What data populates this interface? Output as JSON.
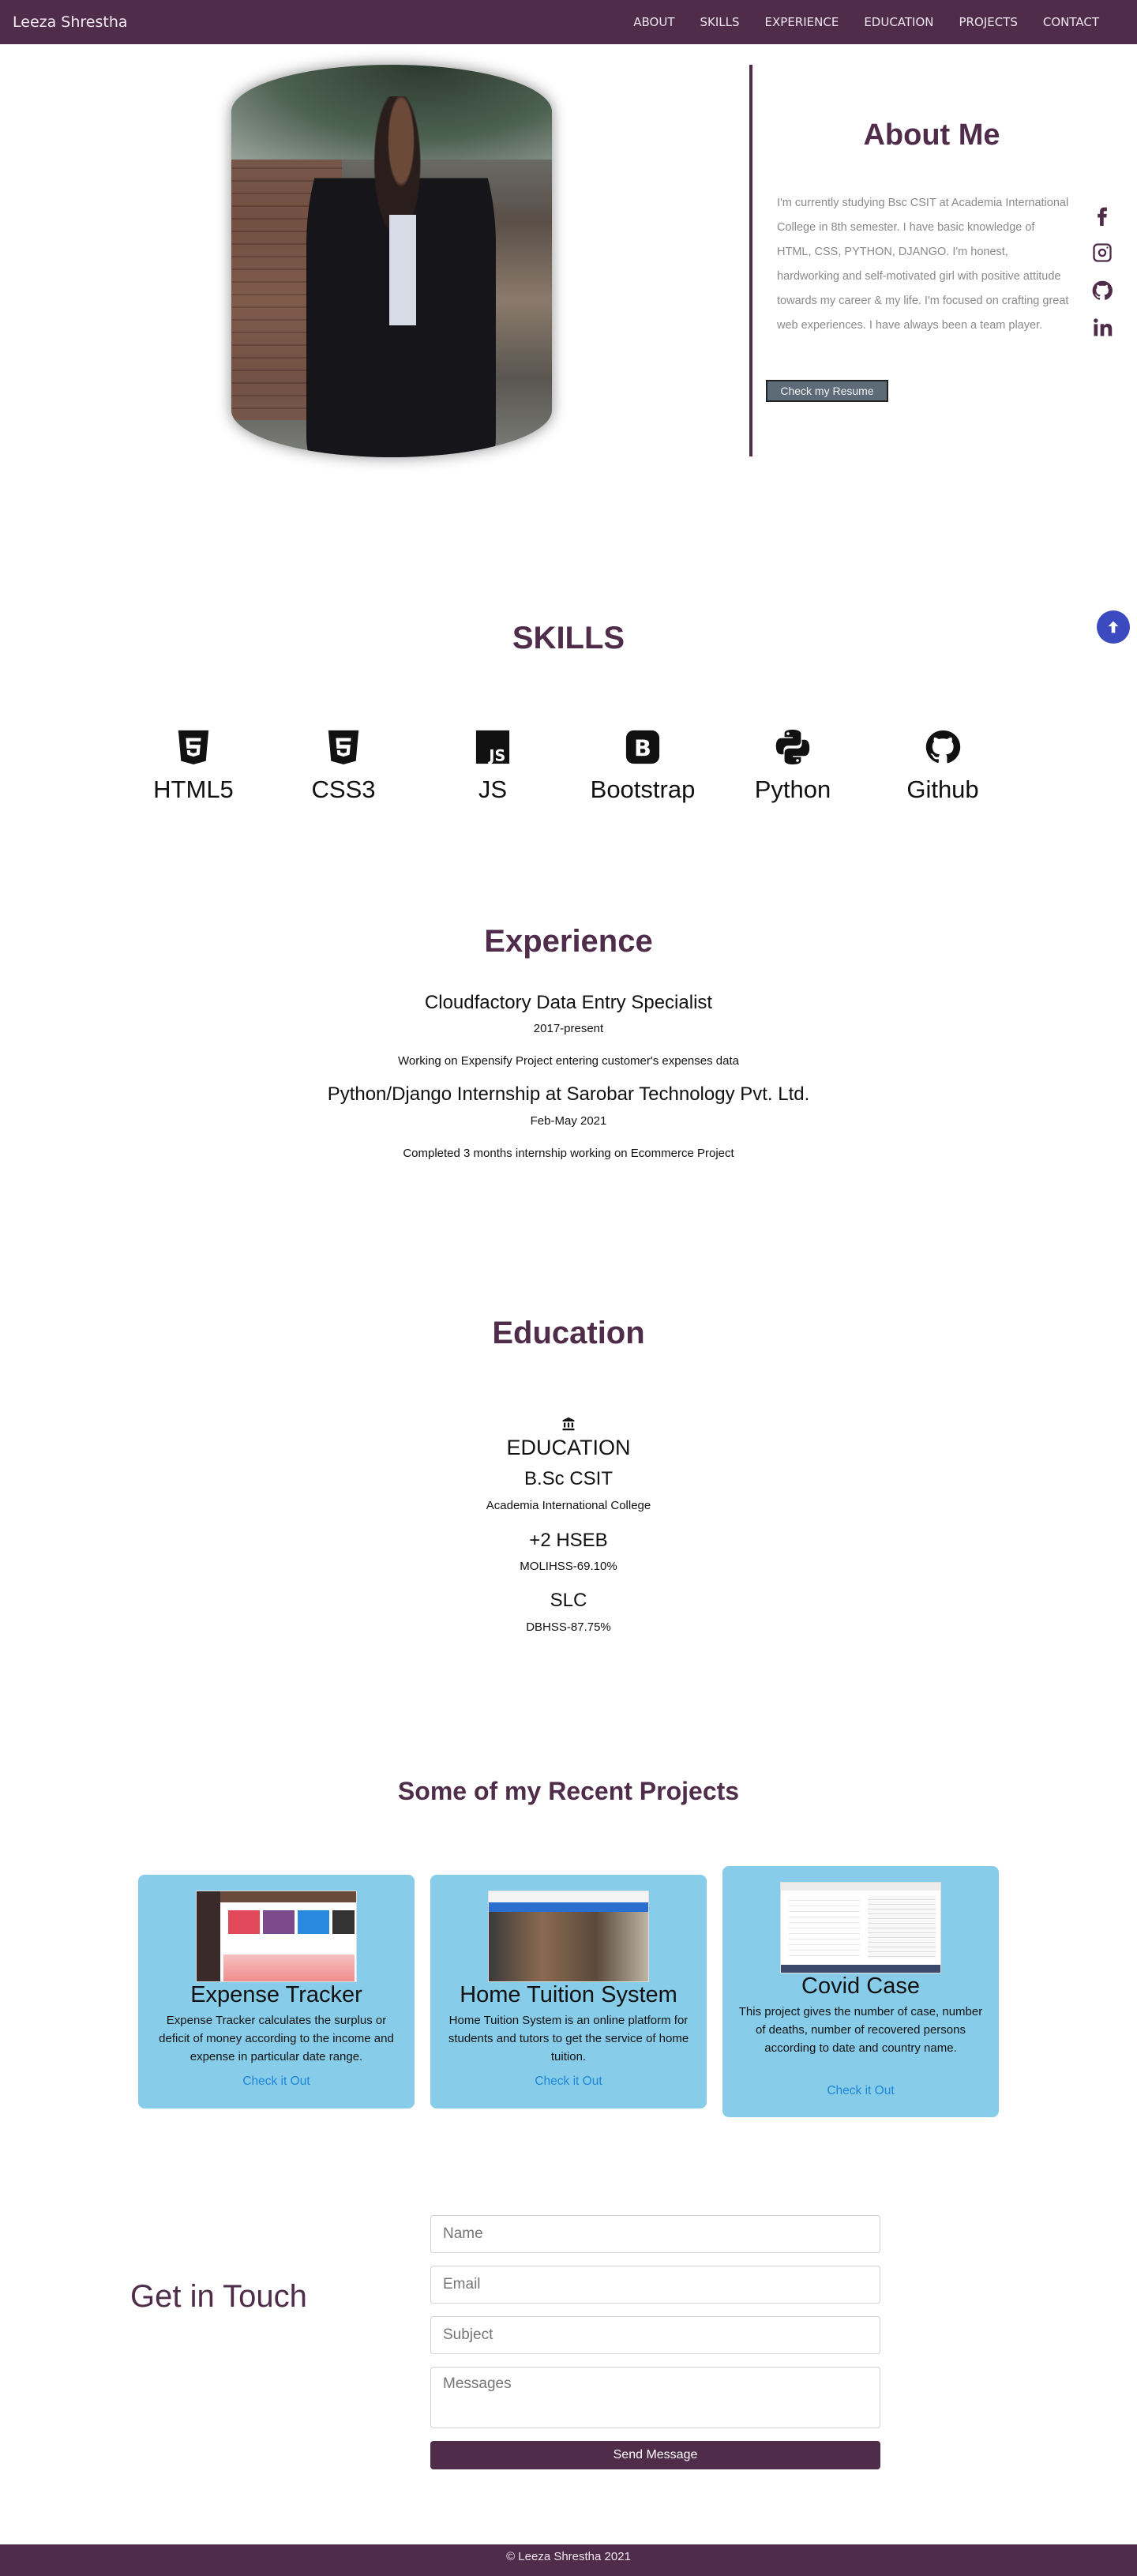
{
  "brand": "Leeza Shrestha",
  "nav": [
    "ABOUT",
    "SKILLS",
    "EXPERIENCE",
    "EDUCATION",
    "PROJECTS",
    "CONTACT"
  ],
  "about": {
    "title": "About Me",
    "text": "I'm currently studying Bsc CSIT at Academia International College in 8th semester. I have basic knowledge of HTML, CSS, PYTHON, DJANGO. I'm honest, hardworking and self-motivated girl with positive attitude towards my career & my life. I'm focused on crafting great web experiences. I have always been a team player.",
    "resume_button": "Check my Resume"
  },
  "social_icons": [
    "facebook-icon",
    "instagram-icon",
    "github-icon",
    "linkedin-icon"
  ],
  "skills": {
    "title": "SKILLS",
    "items": [
      "HTML5",
      "CSS3",
      "JS",
      "Bootstrap",
      "Python",
      "Github"
    ]
  },
  "experience": {
    "title": "Experience",
    "items": [
      {
        "role": "Cloudfactory Data Entry Specialist",
        "period": "2017-present",
        "desc": "Working on Expensify Project entering customer's expenses data"
      },
      {
        "role": "Python/Django Internship at Sarobar Technology Pvt. Ltd.",
        "period": "Feb-May 2021",
        "desc": "Completed 3 months internship working on Ecommerce Project"
      }
    ]
  },
  "education": {
    "title": "Education",
    "heading": "EDUCATION",
    "items": [
      {
        "degree": "B.Sc CSIT",
        "school": "Academia International College"
      },
      {
        "degree": "+2 HSEB",
        "school": "MOLIHSS-69.10%"
      },
      {
        "degree": "SLC",
        "school": "DBHSS-87.75%"
      }
    ]
  },
  "projects": {
    "title": "Some of my Recent Projects",
    "items": [
      {
        "title": "Expense Tracker",
        "desc": "Expense Tracker calculates the surplus or deficit of money according to the income and expense in particular date range.",
        "link": "Check it Out"
      },
      {
        "title": "Home Tuition System",
        "desc": "Home Tuition System is an online platform for students and tutors to get the service of home tuition.",
        "link": "Check it Out"
      },
      {
        "title": "Covid Case",
        "desc": "This project gives the number of case, number of deaths, number of recovered persons according to date and country name.",
        "link": "Check it Out"
      }
    ]
  },
  "contact": {
    "title": "Get in Touch",
    "name_placeholder": "Name",
    "email_placeholder": "Email",
    "subject_placeholder": "Subject",
    "message_placeholder": "Messages",
    "send_button": "Send Message"
  },
  "footer": "© Leeza Shrestha 2021",
  "colors": {
    "primary": "#4f2d4a",
    "card": "#87cde9",
    "link": "#1e86d6",
    "scroll_top": "#3b4bbf"
  }
}
